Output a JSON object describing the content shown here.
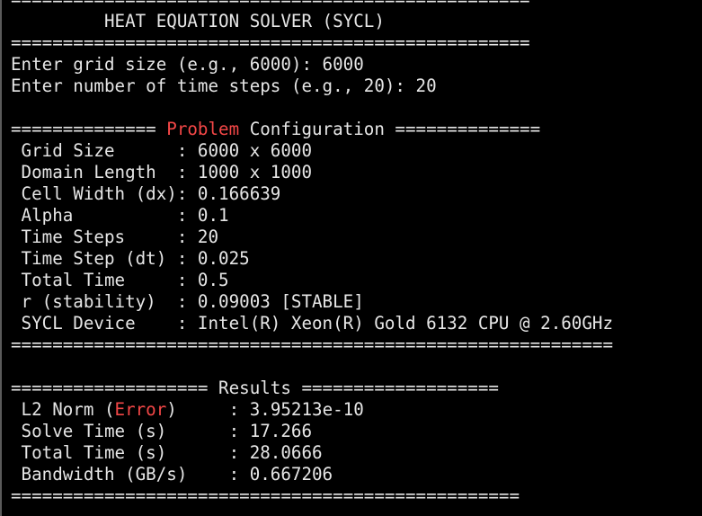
{
  "colors": {
    "background": "#000000",
    "text": "#e6e6e6",
    "highlight": "#f44747"
  },
  "header": {
    "rule_top_partial": "==================================================",
    "title": "         HEAT EQUATION SOLVER (SYCL)",
    "rule_bottom": "=================================================="
  },
  "prompts": [
    "Enter grid size (e.g., 6000): 6000",
    "Enter number of time steps (e.g., 20): 20"
  ],
  "config": {
    "heading_left": "============== ",
    "heading_red": "Problem",
    "heading_right": " Configuration ==============",
    "rows": [
      " Grid Size      : 6000 x 6000",
      " Domain Length  : 1000 x 1000",
      " Cell Width (dx): 0.166639",
      " Alpha          : 0.1",
      " Time Steps     : 20",
      " Time Step (dt) : 0.025",
      " Total Time     : 0.5",
      " r (stability)  : 0.09003 [STABLE]",
      " SYCL Device    : Intel(R) Xeon(R) Gold 6132 CPU @ 2.60GHz"
    ],
    "rule": "=========================================================="
  },
  "results": {
    "heading": "=================== Results ===================",
    "l2_prefix": " L2 Norm (",
    "l2_red": "Error",
    "l2_suffix": ")     : 3.95213e-10",
    "rows": [
      " Solve Time (s)      : 17.266",
      " Total Time (s)      : 28.0666",
      " Bandwidth (GB/s)    : 0.667206"
    ],
    "rule": "================================================="
  }
}
